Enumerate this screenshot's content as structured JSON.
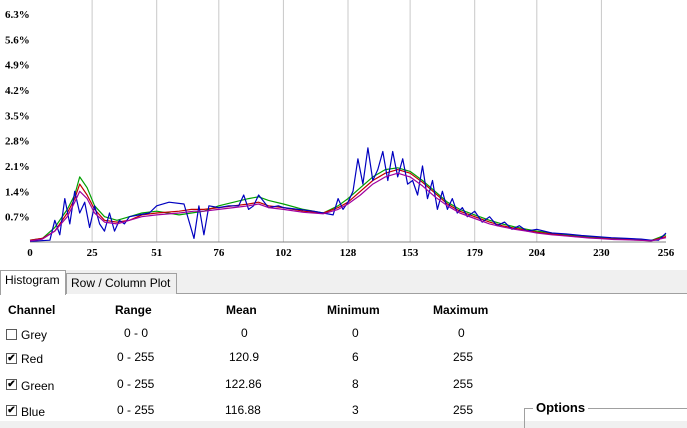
{
  "chart_data": {
    "type": "line",
    "y_ticks": [
      "0.7%",
      "1.4%",
      "2.1%",
      "2.8%",
      "3.5%",
      "4.2%",
      "4.9%",
      "5.6%",
      "6.3%"
    ],
    "x_ticks": [
      "0",
      "25",
      "51",
      "76",
      "102",
      "128",
      "153",
      "179",
      "204",
      "230",
      "256"
    ],
    "xlim": [
      0,
      256
    ],
    "ylim": [
      0,
      6.3
    ],
    "grid": "vertical",
    "series": [
      {
        "color": "#00a000",
        "x": [
          0,
          5,
          10,
          15,
          18,
          20,
          23,
          26,
          30,
          35,
          40,
          45,
          51,
          60,
          65,
          70,
          76,
          82,
          88,
          92,
          96,
          102,
          110,
          118,
          124,
          128,
          133,
          138,
          143,
          148,
          153,
          158,
          163,
          168,
          173,
          179,
          185,
          190,
          195,
          200,
          204,
          210,
          215,
          220,
          225,
          230,
          235,
          240,
          245,
          250,
          256
        ],
        "y": [
          0.05,
          0.1,
          0.4,
          0.9,
          1.3,
          1.8,
          1.5,
          1.0,
          0.7,
          0.6,
          0.7,
          0.8,
          0.85,
          0.75,
          0.8,
          0.85,
          1.0,
          1.1,
          1.2,
          1.25,
          1.15,
          1.05,
          0.9,
          0.8,
          1.0,
          1.2,
          1.5,
          1.8,
          2.0,
          2.05,
          1.95,
          1.7,
          1.4,
          1.1,
          0.9,
          0.75,
          0.6,
          0.5,
          0.42,
          0.35,
          0.3,
          0.25,
          0.2,
          0.17,
          0.14,
          0.12,
          0.1,
          0.08,
          0.06,
          0.04,
          0.2
        ]
      },
      {
        "color": "#c00000",
        "x": [
          0,
          5,
          10,
          15,
          18,
          20,
          23,
          26,
          30,
          35,
          40,
          45,
          51,
          60,
          65,
          70,
          76,
          82,
          88,
          92,
          96,
          102,
          110,
          118,
          124,
          128,
          133,
          138,
          143,
          148,
          153,
          158,
          163,
          168,
          173,
          179,
          185,
          190,
          195,
          200,
          204,
          210,
          215,
          220,
          225,
          230,
          235,
          240,
          245,
          250,
          256
        ],
        "y": [
          0.05,
          0.1,
          0.3,
          0.8,
          1.2,
          1.6,
          1.3,
          0.9,
          0.6,
          0.55,
          0.6,
          0.75,
          0.8,
          0.85,
          0.9,
          0.9,
          0.95,
          1.0,
          1.05,
          1.1,
          1.0,
          0.95,
          0.85,
          0.8,
          0.95,
          1.1,
          1.4,
          1.7,
          1.9,
          2.0,
          1.9,
          1.65,
          1.35,
          1.05,
          0.85,
          0.7,
          0.55,
          0.45,
          0.38,
          0.32,
          0.27,
          0.22,
          0.18,
          0.15,
          0.12,
          0.1,
          0.08,
          0.07,
          0.05,
          0.04,
          0.15
        ]
      },
      {
        "color": "#0000c0",
        "x": [
          0,
          8,
          10,
          12,
          14,
          16,
          18,
          20,
          22,
          24,
          26,
          28,
          30,
          32,
          34,
          36,
          38,
          40,
          44,
          48,
          51,
          56,
          62,
          66,
          68,
          70,
          72,
          76,
          80,
          84,
          86,
          88,
          90,
          92,
          96,
          100,
          102,
          108,
          114,
          118,
          122,
          124,
          126,
          128,
          130,
          132,
          134,
          136,
          138,
          140,
          142,
          144,
          146,
          148,
          150,
          152,
          154,
          156,
          158,
          160,
          162,
          164,
          166,
          168,
          170,
          172,
          174,
          176,
          179,
          182,
          185,
          188,
          191,
          194,
          197,
          200,
          204,
          210,
          216,
          222,
          228,
          234,
          240,
          246,
          250,
          253,
          256
        ],
        "y": [
          0.02,
          0.05,
          0.6,
          0.2,
          1.2,
          0.5,
          1.4,
          0.8,
          1.1,
          0.4,
          1.0,
          0.5,
          0.3,
          0.8,
          0.3,
          0.6,
          0.5,
          0.7,
          0.75,
          0.8,
          1.0,
          1.1,
          1.05,
          0.1,
          1.0,
          0.2,
          1.0,
          0.95,
          1.0,
          1.0,
          1.3,
          0.9,
          1.0,
          1.3,
          0.95,
          1.0,
          0.95,
          0.9,
          0.85,
          0.8,
          0.75,
          1.2,
          0.9,
          1.1,
          1.4,
          2.3,
          1.6,
          2.6,
          1.7,
          2.0,
          2.5,
          1.7,
          2.5,
          1.8,
          2.3,
          1.6,
          1.7,
          1.3,
          2.1,
          1.2,
          1.7,
          0.9,
          1.4,
          0.9,
          1.2,
          0.8,
          0.95,
          0.7,
          0.85,
          0.55,
          0.7,
          0.45,
          0.55,
          0.35,
          0.45,
          0.3,
          0.35,
          0.25,
          0.22,
          0.18,
          0.15,
          0.12,
          0.1,
          0.08,
          0.05,
          0.05,
          0.25
        ]
      },
      {
        "color": "#a000a0",
        "x": [
          0,
          5,
          10,
          15,
          18,
          20,
          23,
          26,
          30,
          35,
          40,
          45,
          51,
          60,
          66,
          70,
          76,
          82,
          88,
          92,
          96,
          102,
          110,
          118,
          124,
          128,
          133,
          138,
          143,
          148,
          153,
          158,
          163,
          168,
          173,
          179,
          185,
          190,
          195,
          200,
          204,
          210,
          215,
          220,
          225,
          230,
          235,
          240,
          245,
          250,
          256
        ],
        "y": [
          0.03,
          0.08,
          0.3,
          0.7,
          1.1,
          1.4,
          1.2,
          0.8,
          0.55,
          0.5,
          0.6,
          0.7,
          0.75,
          0.8,
          0.85,
          0.85,
          0.9,
          0.95,
          1.0,
          1.05,
          0.95,
          0.9,
          0.82,
          0.78,
          0.9,
          1.05,
          1.3,
          1.6,
          1.8,
          1.9,
          1.8,
          1.55,
          1.25,
          1.0,
          0.8,
          0.65,
          0.5,
          0.42,
          0.35,
          0.3,
          0.25,
          0.2,
          0.17,
          0.14,
          0.11,
          0.09,
          0.07,
          0.06,
          0.05,
          0.03,
          0.12
        ]
      }
    ]
  },
  "tabs": [
    {
      "label": "Histogram"
    },
    {
      "label": "Row / Column Plot"
    }
  ],
  "table": {
    "headers": {
      "channel": "Channel",
      "range": "Range",
      "mean": "Mean",
      "minimum": "Minimum",
      "maximum": "Maximum"
    },
    "rows": [
      {
        "name": "Grey",
        "checked": false,
        "range": "0 - 0",
        "mean": "0",
        "minimum": "0",
        "maximum": "0"
      },
      {
        "name": "Red",
        "checked": true,
        "range": "0 - 255",
        "mean": "120.9",
        "minimum": "6",
        "maximum": "255"
      },
      {
        "name": "Green",
        "checked": true,
        "range": "0 - 255",
        "mean": "122.86",
        "minimum": "8",
        "maximum": "255"
      },
      {
        "name": "Blue",
        "checked": true,
        "range": "0 - 255",
        "mean": "116.88",
        "minimum": "3",
        "maximum": "255"
      }
    ]
  },
  "options": {
    "label": "Options"
  }
}
